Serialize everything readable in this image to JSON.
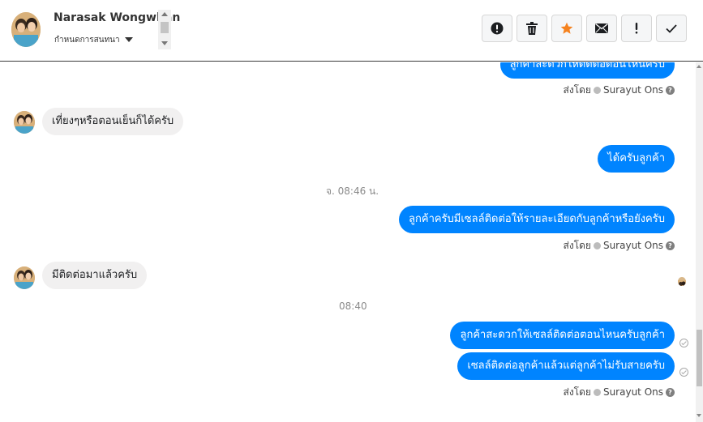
{
  "header": {
    "contact_name": "Narasak Wongwhan",
    "conversation_settings": "กำหนดการสนทนา",
    "toolbar": [
      {
        "name": "mark-spam-button",
        "icon": "exclamation-circle-icon"
      },
      {
        "name": "delete-button",
        "icon": "trash-icon"
      },
      {
        "name": "star-button",
        "icon": "star-icon",
        "color": "#f5821f"
      },
      {
        "name": "mark-unread-button",
        "icon": "envelope-icon"
      },
      {
        "name": "mark-important-button",
        "icon": "exclamation-icon"
      },
      {
        "name": "mark-done-button",
        "icon": "check-icon"
      }
    ]
  },
  "colors": {
    "outgoing_bubble": "#0084ff",
    "incoming_bubble": "#f1f0f0",
    "star": "#f5821f"
  },
  "messages": [
    {
      "dir": "out",
      "text": "ลูกค้าสะดวกให้ติดต่อตอนไหนครับ"
    },
    {
      "sent_by_label": "ส่งโดย",
      "sent_by_name": "Surayut Ons"
    },
    {
      "dir": "in",
      "text": "เที่ยงๆหรือตอนเย็นก็ได้ครับ"
    },
    {
      "dir": "out",
      "text": "ได้ครับลูกค้า"
    },
    {
      "timestamp": "จ. 08:46 น."
    },
    {
      "dir": "out",
      "text": "ลูกค้าครับมีเซลล์ติดต่อให้รายละเอียดกับลูกค้าหรือยังครับ"
    },
    {
      "sent_by_label": "ส่งโดย",
      "sent_by_name": "Surayut Ons"
    },
    {
      "dir": "in",
      "text": "มีติดต่อมาแล้วครับ"
    },
    {
      "timestamp": "08:40"
    },
    {
      "dir": "out",
      "text": "ลูกค้าสะดวกให้เซลล์ติดต่อตอนไหนครับลูกค้า"
    },
    {
      "dir": "out",
      "text": "เซลล์ติดต่อลูกค้าแล้วแต่ลูกค้าไม่รับสายครับ"
    },
    {
      "sent_by_label": "ส่งโดย",
      "sent_by_name": "Surayut Ons"
    }
  ]
}
